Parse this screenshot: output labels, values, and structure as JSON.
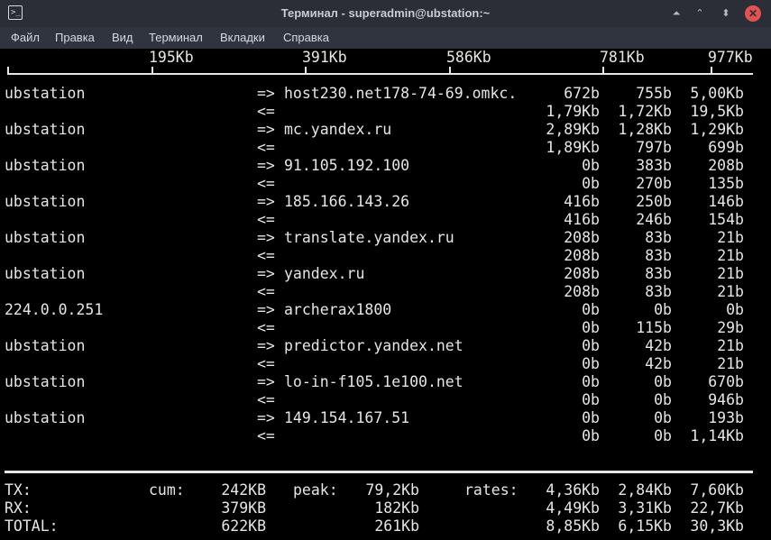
{
  "window": {
    "title": "Терминал - superadmin@ubstation:~",
    "icon": "terminal-icon",
    "buttons": {
      "up": "⏶",
      "minimize": "⌃",
      "maximize": "⬍",
      "close": "✕"
    }
  },
  "menu": [
    "Файл",
    "Правка",
    "Вид",
    "Терминал",
    "Вкладки",
    "Справка"
  ],
  "scale": [
    "195Kb",
    "391Kb",
    "586Kb",
    "781Kb",
    "977Kb"
  ],
  "rows": [
    {
      "src": "ubstation",
      "dst": "host230.net178-74-69.omkc.",
      "out": [
        "672b",
        "755b",
        "5,00Kb"
      ],
      "in": [
        "1,79Kb",
        "1,72Kb",
        "19,5Kb"
      ]
    },
    {
      "src": "ubstation",
      "dst": "mc.yandex.ru",
      "out": [
        "2,89Kb",
        "1,28Kb",
        "1,29Kb"
      ],
      "in": [
        "1,89Kb",
        "797b",
        "699b"
      ]
    },
    {
      "src": "ubstation",
      "dst": "91.105.192.100",
      "out": [
        "0b",
        "383b",
        "208b"
      ],
      "in": [
        "0b",
        "270b",
        "135b"
      ]
    },
    {
      "src": "ubstation",
      "dst": "185.166.143.26",
      "out": [
        "416b",
        "250b",
        "146b"
      ],
      "in": [
        "416b",
        "246b",
        "154b"
      ]
    },
    {
      "src": "ubstation",
      "dst": "translate.yandex.ru",
      "out": [
        "208b",
        "83b",
        "21b"
      ],
      "in": [
        "208b",
        "83b",
        "21b"
      ]
    },
    {
      "src": "ubstation",
      "dst": "yandex.ru",
      "out": [
        "208b",
        "83b",
        "21b"
      ],
      "in": [
        "208b",
        "83b",
        "21b"
      ]
    },
    {
      "src": "224.0.0.251",
      "dst": "archerax1800",
      "out": [
        "0b",
        "0b",
        "0b"
      ],
      "in": [
        "0b",
        "115b",
        "29b"
      ]
    },
    {
      "src": "ubstation",
      "dst": "predictor.yandex.net",
      "out": [
        "0b",
        "42b",
        "21b"
      ],
      "in": [
        "0b",
        "42b",
        "21b"
      ]
    },
    {
      "src": "ubstation",
      "dst": "lo-in-f105.1e100.net",
      "out": [
        "0b",
        "0b",
        "670b"
      ],
      "in": [
        "0b",
        "0b",
        "946b"
      ]
    },
    {
      "src": "ubstation",
      "dst": "149.154.167.51",
      "out": [
        "0b",
        "0b",
        "193b"
      ],
      "in": [
        "0b",
        "0b",
        "1,14Kb"
      ]
    }
  ],
  "arrows": {
    "out": "=>",
    "in": "<="
  },
  "totals": {
    "cum_label": "cum:",
    "peak_label": "peak:",
    "rates_label": "rates:",
    "tx": {
      "label": "TX:",
      "cum": "242KB",
      "peak": "79,2Kb",
      "rates": [
        "4,36Kb",
        "2,84Kb",
        "7,60Kb"
      ]
    },
    "rx": {
      "label": "RX:",
      "cum": "379KB",
      "peak": "182Kb",
      "rates": [
        "4,49Kb",
        "3,31Kb",
        "22,7Kb"
      ]
    },
    "total": {
      "label": "TOTAL:",
      "cum": "622KB",
      "peak": "261Kb",
      "rates": [
        "8,85Kb",
        "6,15Kb",
        "30,3Kb"
      ]
    }
  }
}
